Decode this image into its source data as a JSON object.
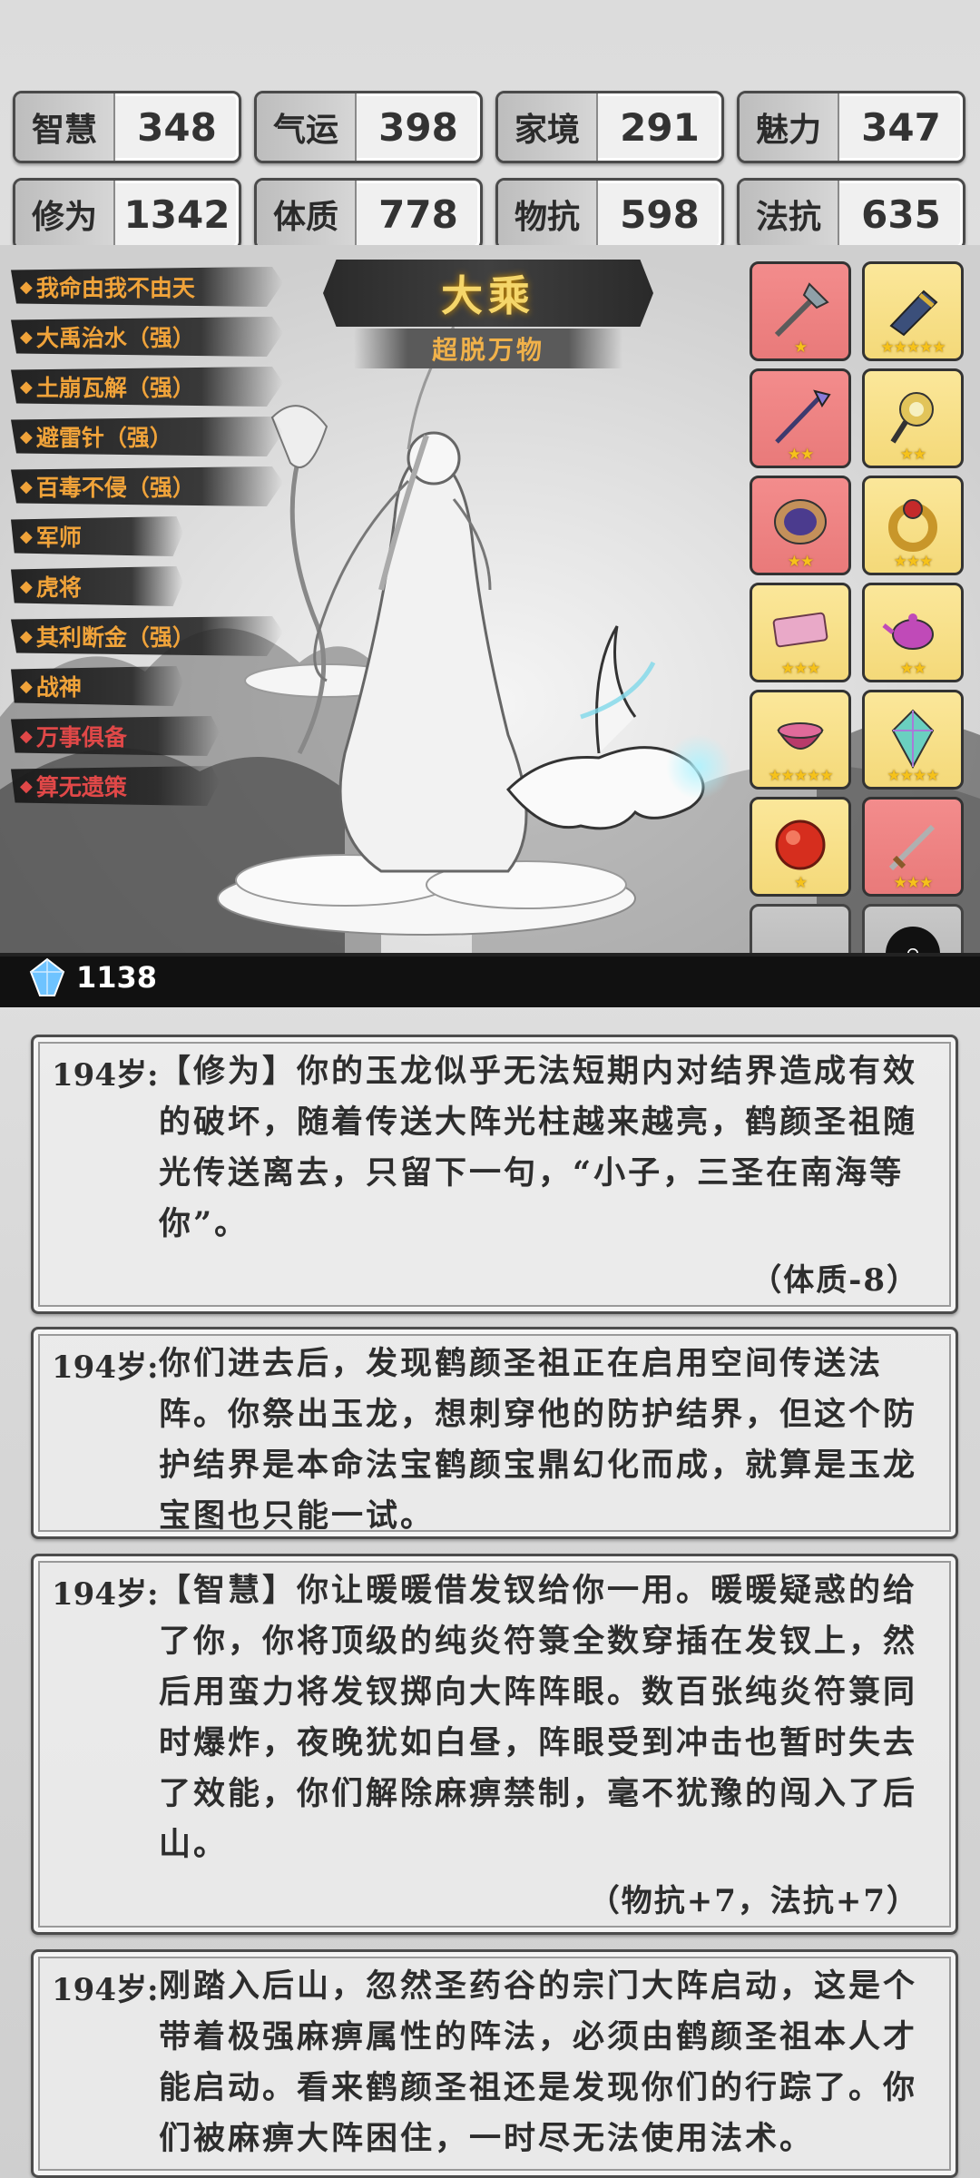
{
  "stats": [
    {
      "label": "智慧",
      "value": "348"
    },
    {
      "label": "气运",
      "value": "398"
    },
    {
      "label": "家境",
      "value": "291"
    },
    {
      "label": "魅力",
      "value": "347"
    },
    {
      "label": "修为",
      "value": "1342"
    },
    {
      "label": "体质",
      "value": "778"
    },
    {
      "label": "物抗",
      "value": "598"
    },
    {
      "label": "法抗",
      "value": "635"
    }
  ],
  "skills": [
    {
      "label": "我命由我不由天",
      "color": "#f0a33a"
    },
    {
      "label": "大禹治水（强）",
      "color": "#f0a33a"
    },
    {
      "label": "土崩瓦解（强）",
      "color": "#f0a33a"
    },
    {
      "label": "避雷针（强）",
      "color": "#f0a33a"
    },
    {
      "label": "百毒不侵（强）",
      "color": "#f0a33a"
    },
    {
      "label": "军师",
      "color": "#f0a33a"
    },
    {
      "label": "虎将",
      "color": "#f0a33a"
    },
    {
      "label": "其利断金（强）",
      "color": "#f0a33a"
    },
    {
      "label": "战神",
      "color": "#f0a33a"
    },
    {
      "label": "万事俱备",
      "color": "#e04848"
    },
    {
      "label": "算无遗策",
      "color": "#e04848"
    }
  ],
  "realm": {
    "title": "大乘",
    "subtitle": "超脱万物"
  },
  "currency": {
    "icon": "crystal-icon",
    "value": "1138"
  },
  "items": [
    {
      "name": "halberd-icon",
      "bg": "red",
      "stars": "★"
    },
    {
      "name": "gauntlet-icon",
      "bg": "gold",
      "stars": "★★★★★"
    },
    {
      "name": "spear-icon",
      "bg": "red",
      "stars": "★★"
    },
    {
      "name": "mace-icon",
      "bg": "gold",
      "stars": "★★"
    },
    {
      "name": "mirror-icon",
      "bg": "red",
      "stars": "★★"
    },
    {
      "name": "ring-icon",
      "bg": "gold",
      "stars": "★★★"
    },
    {
      "name": "scroll-icon",
      "bg": "gold",
      "stars": "★★★"
    },
    {
      "name": "teapot-icon",
      "bg": "gold",
      "stars": "★★"
    },
    {
      "name": "cauldron-icon",
      "bg": "gold",
      "stars": "★★★★★"
    },
    {
      "name": "crystal-gem-icon",
      "bg": "gold",
      "stars": "★★★★"
    },
    {
      "name": "red-orb-icon",
      "bg": "gold",
      "stars": "★"
    },
    {
      "name": "sword-icon",
      "bg": "red",
      "stars": "★★★"
    }
  ],
  "log": [
    {
      "age": "194岁:",
      "text": "【修为】你的玉龙似乎无法短期内对结界造成有效的破坏，随着传送大阵光柱越来越亮，鹤颜圣祖随光传送离去，只留下一句，“小子，三圣在南海等你”。",
      "delta": "（体质-8）"
    },
    {
      "age": "194岁:",
      "text": "你们进去后，发现鹤颜圣祖正在启用空间传送法阵。你祭出玉龙，想刺穿他的防护结界，但这个防护结界是本命法宝鹤颜宝鼎幻化而成，就算是玉龙宝图也只能一试。",
      "delta": ""
    },
    {
      "age": "194岁:",
      "text": "【智慧】你让暖暖借发钗给你一用。暖暖疑惑的给了你，你将顶级的纯炎符箓全数穿插在发钗上，然后用蛮力将发钗掷向大阵阵眼。数百张纯炎符箓同时爆炸，夜晚犹如白昼，阵眼受到冲击也暂时失去了效能，你们解除麻痹禁制，毫不犹豫的闯入了后山。",
      "delta": "（物抗+7，法抗+7）"
    },
    {
      "age": "194岁:",
      "text": "刚踏入后山，忽然圣药谷的宗门大阵启动，这是个带着极强麻痹属性的阵法，必须由鹤颜圣祖本人才能启动。看来鹤颜圣祖还是发现你们的行踪了。你们被麻痹大阵困住，一时尽无法使用法术。",
      "delta": ""
    }
  ]
}
